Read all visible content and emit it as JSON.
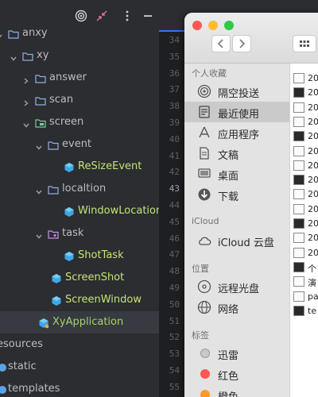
{
  "ide": {
    "tree": [
      {
        "label": "anxy",
        "kind": "folder",
        "depth": 0,
        "open": true
      },
      {
        "label": "xy",
        "kind": "folder",
        "depth": 1,
        "open": true
      },
      {
        "label": "answer",
        "kind": "folder",
        "depth": 2,
        "open": false
      },
      {
        "label": "scan",
        "kind": "folder",
        "depth": 2,
        "open": false
      },
      {
        "label": "screen",
        "kind": "folder-special",
        "depth": 2,
        "open": true
      },
      {
        "label": "event",
        "kind": "folder",
        "depth": 3,
        "open": true
      },
      {
        "label": "ReSizeEvent",
        "kind": "class",
        "depth": 4
      },
      {
        "label": "localtion",
        "kind": "folder",
        "depth": 3,
        "open": true
      },
      {
        "label": "WindowLocation",
        "kind": "class",
        "depth": 4
      },
      {
        "label": "task",
        "kind": "folder-pink",
        "depth": 3,
        "open": true
      },
      {
        "label": "ShotTask",
        "kind": "class",
        "depth": 4
      },
      {
        "label": "ScreenShot",
        "kind": "class",
        "depth": 3
      },
      {
        "label": "ScreenWindow",
        "kind": "class",
        "depth": 3
      },
      {
        "label": "XyApplication",
        "kind": "class-main",
        "depth": 2
      },
      {
        "label": "esources",
        "kind": "plain",
        "depth": 0
      },
      {
        "label": "static",
        "kind": "web",
        "depth": 0
      },
      {
        "label": "templates",
        "kind": "web",
        "depth": 0
      }
    ],
    "line_numbers": [
      "34",
      "35",
      "36",
      "37",
      "38",
      "39",
      "40",
      "41",
      "42",
      "43",
      "44",
      "45",
      "46",
      "47",
      "48",
      "49",
      "50",
      "51",
      "52",
      "53",
      "54",
      "55",
      "56"
    ],
    "current_line": "43",
    "colors": {
      "selection": "#2e436e",
      "class_text": "#c5e478",
      "accent_tab": "#3574f0"
    },
    "toolbar_icons": [
      "target-icon",
      "collapse-icon",
      "more-icon",
      "minimize-icon"
    ]
  },
  "finder": {
    "sections": [
      {
        "title": "个人收藏",
        "items": [
          {
            "label": "隔空投送",
            "icon": "airdrop-icon"
          },
          {
            "label": "最近使用",
            "icon": "recents-icon",
            "active": true
          },
          {
            "label": "应用程序",
            "icon": "applications-icon"
          },
          {
            "label": "文稿",
            "icon": "documents-icon"
          },
          {
            "label": "桌面",
            "icon": "desktop-icon"
          },
          {
            "label": "下载",
            "icon": "downloads-icon"
          }
        ]
      },
      {
        "title": "iCloud",
        "items": [
          {
            "label": "iCloud 云盘",
            "icon": "cloud-icon"
          }
        ]
      },
      {
        "title": "位置",
        "items": [
          {
            "label": "远程光盘",
            "icon": "disc-icon"
          },
          {
            "label": "网络",
            "icon": "network-icon"
          }
        ]
      },
      {
        "title": "标签",
        "items": [
          {
            "label": "迅雷",
            "icon": "tag-icon",
            "color": "#c8c8c8"
          },
          {
            "label": "红色",
            "icon": "tag-icon",
            "color": "#fc5753"
          },
          {
            "label": "橙色",
            "icon": "tag-icon",
            "color": "#fd9a2e"
          }
        ]
      }
    ],
    "files": [
      "20",
      "20",
      "20",
      "20",
      "20",
      "20",
      "20",
      "20",
      "20",
      "20",
      "20",
      "20",
      "20",
      "个",
      "演",
      "pa",
      "te"
    ],
    "traffic_lights": [
      "#fc5753",
      "#fdbc2e",
      "#33c748"
    ]
  }
}
